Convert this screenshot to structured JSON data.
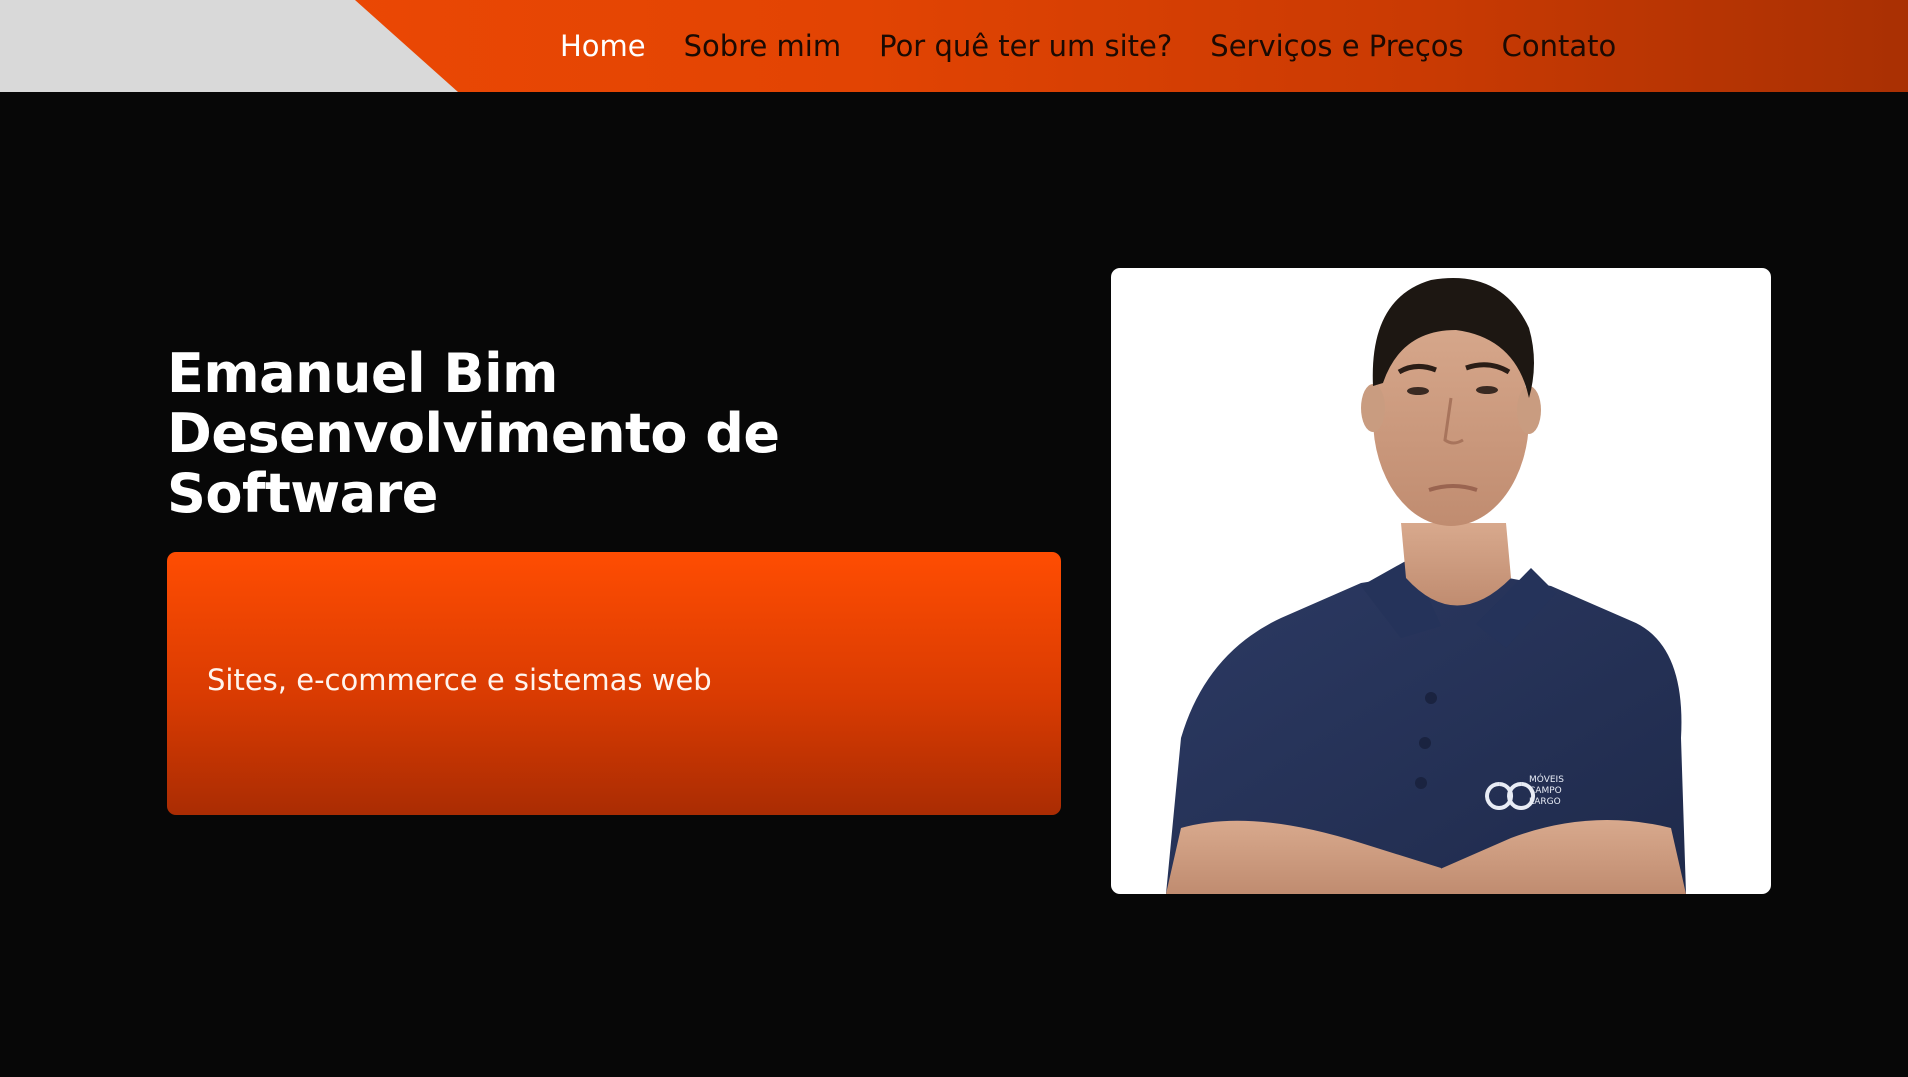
{
  "nav": {
    "items": [
      {
        "label": "Home",
        "active": true
      },
      {
        "label": "Sobre mim",
        "active": false
      },
      {
        "label": "Por quê ter um site?",
        "active": false
      },
      {
        "label": "Serviços e Preços",
        "active": false
      },
      {
        "label": "Contato",
        "active": false
      }
    ]
  },
  "hero": {
    "title_lines": [
      "Emanuel Bim",
      "Desenvolvimento de",
      "Software"
    ],
    "tagline": "Sites, e-commerce e sistemas web"
  },
  "photo": {
    "shirt_logo_lines": [
      "MÓVEIS",
      "CAMPO",
      "LARGO"
    ]
  },
  "colors": {
    "accent": "#f04a04",
    "accent_dark": "#a93003",
    "background": "#070707",
    "logo_area": "#d9d9d9",
    "nav_text": "#1b0a03",
    "nav_active": "#ffffff"
  }
}
